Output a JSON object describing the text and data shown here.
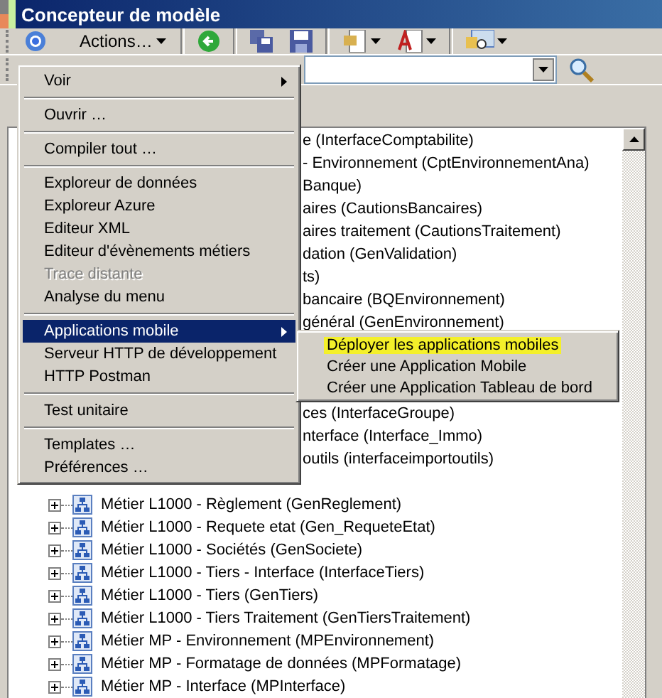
{
  "window": {
    "title": "Concepteur de modèle"
  },
  "toolbar": {
    "actions_label": "Actions…"
  },
  "tree": {
    "row_groups": [
      {
        "covered": true,
        "rows": [
          "e (InterfaceComptabilite)",
          "- Environnement (CptEnvironnementAna)",
          "Banque)",
          "aires (CautionsBancaires)",
          "aires traitement (CautionsTraitement)",
          "dation (GenValidation)",
          "ts)",
          "bancaire (BQEnvironnement)",
          "général (GenEnvironnement)"
        ]
      },
      {
        "covered": true,
        "rows": [
          "ces (InterfaceGroupe)",
          "nterface (Interface_Immo)",
          "outils (interfaceimportoutils)"
        ]
      },
      {
        "covered": false,
        "rows": [
          "Métier L1000 - Règlement (GenReglement)",
          "Métier L1000 - Requete etat (Gen_RequeteEtat)",
          "Métier L1000 - Sociétés (GenSociete)",
          "Métier L1000 - Tiers - Interface (InterfaceTiers)",
          "Métier L1000 - Tiers (GenTiers)",
          "Métier L1000 - Tiers Traitement (GenTiersTraitement)",
          "Métier MP - Environnement (MPEnvironnement)",
          "Métier MP - Formatage de données (MPFormatage)",
          "Métier MP - Interface (MPInterface)"
        ]
      }
    ]
  },
  "menu": {
    "items": [
      {
        "kind": "item",
        "label": "Voir",
        "submenu": true,
        "selected": false,
        "disabled": false
      },
      {
        "kind": "separator"
      },
      {
        "kind": "item",
        "label": "Ouvrir …",
        "submenu": false,
        "selected": false,
        "disabled": false
      },
      {
        "kind": "separator"
      },
      {
        "kind": "item",
        "label": "Compiler tout …",
        "submenu": false,
        "selected": false,
        "disabled": false
      },
      {
        "kind": "separator"
      },
      {
        "kind": "item",
        "label": "Exploreur de données",
        "submenu": false,
        "selected": false,
        "disabled": false
      },
      {
        "kind": "item",
        "label": "Exploreur Azure",
        "submenu": false,
        "selected": false,
        "disabled": false
      },
      {
        "kind": "item",
        "label": "Editeur XML",
        "submenu": false,
        "selected": false,
        "disabled": false
      },
      {
        "kind": "item",
        "label": "Editeur d'évènements métiers",
        "submenu": false,
        "selected": false,
        "disabled": false
      },
      {
        "kind": "item",
        "label": "Trace distante",
        "submenu": false,
        "selected": false,
        "disabled": true
      },
      {
        "kind": "item",
        "label": "Analyse du menu",
        "submenu": false,
        "selected": false,
        "disabled": false
      },
      {
        "kind": "separator"
      },
      {
        "kind": "item",
        "label": "Applications mobile",
        "submenu": true,
        "selected": true,
        "disabled": false
      },
      {
        "kind": "item",
        "label": "Serveur HTTP de développement",
        "submenu": false,
        "selected": false,
        "disabled": false
      },
      {
        "kind": "item",
        "label": "HTTP Postman",
        "submenu": false,
        "selected": false,
        "disabled": false
      },
      {
        "kind": "separator"
      },
      {
        "kind": "item",
        "label": "Test unitaire",
        "submenu": false,
        "selected": false,
        "disabled": false
      },
      {
        "kind": "separator"
      },
      {
        "kind": "item",
        "label": "Templates …",
        "submenu": false,
        "selected": false,
        "disabled": false
      },
      {
        "kind": "item",
        "label": "Préférences …",
        "submenu": false,
        "selected": false,
        "disabled": false
      }
    ]
  },
  "submenu": {
    "items": [
      {
        "label": "Déployer les applications mobiles",
        "highlighted": true
      },
      {
        "label": "Créer une Application Mobile",
        "highlighted": false
      },
      {
        "label": "Créer une Application Tableau de bord",
        "highlighted": false
      }
    ]
  }
}
